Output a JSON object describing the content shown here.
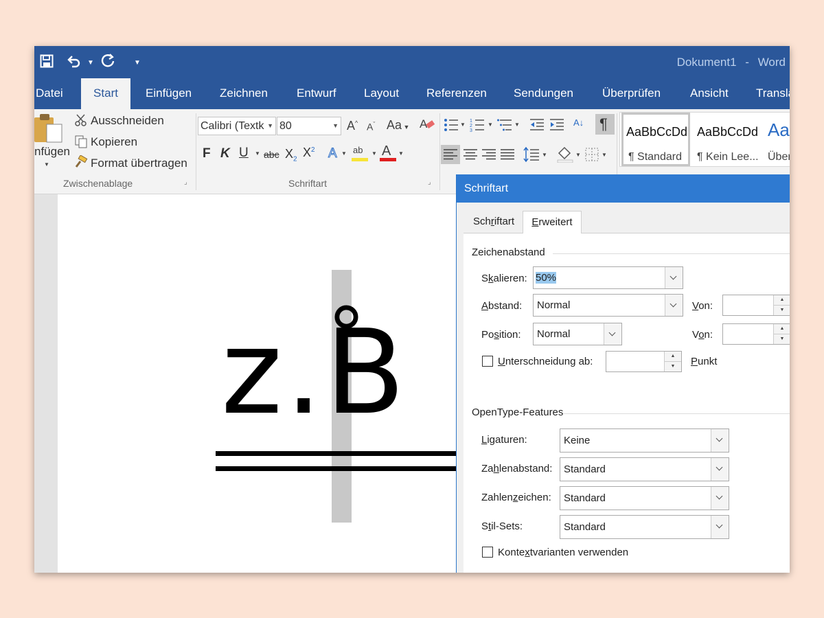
{
  "qat": {
    "save_icon": "save-icon",
    "undo_icon": "undo-icon",
    "redo_icon": "redo-icon",
    "customize_icon": "customize-qat-icon"
  },
  "title": {
    "doc": "Dokument1",
    "sep": "-",
    "app": "Word"
  },
  "tabs": [
    {
      "label": "Datei"
    },
    {
      "label": "Start"
    },
    {
      "label": "Einfügen"
    },
    {
      "label": "Zeichnen"
    },
    {
      "label": "Entwurf"
    },
    {
      "label": "Layout"
    },
    {
      "label": "Referenzen"
    },
    {
      "label": "Sendungen"
    },
    {
      "label": "Überprüfen"
    },
    {
      "label": "Ansicht"
    },
    {
      "label": "Transla"
    }
  ],
  "clipboard": {
    "paste_label": "nfügen",
    "cut_label": "Ausschneiden",
    "copy_label": "Kopieren",
    "format_label": "Format übertragen",
    "group_label": "Zwischenablage"
  },
  "font": {
    "font_name": "Calibri (Textk",
    "font_size": "80",
    "grow_label": "A",
    "shrink_label": "A",
    "case_label": "Aa",
    "bold": "F",
    "italic": "K",
    "underline": "U",
    "strike": "abc",
    "subscript": "X",
    "superscript": "X",
    "sub_mark": "2",
    "sup_mark": "2",
    "effects": "A",
    "highlight": "ab",
    "color": "A",
    "group_label": "Schriftart"
  },
  "paragraph": {
    "pilcrow": "¶",
    "sort": "A↓"
  },
  "styles": [
    {
      "sample": "AaBbCcDd",
      "name": "¶ Standard"
    },
    {
      "sample": "AaBbCcDd",
      "name": "¶ Kein Lee..."
    },
    {
      "sample": "Aa",
      "name": "Über"
    }
  ],
  "document": {
    "text": "z.B",
    "degree": "°"
  },
  "dialog": {
    "title": "Schriftart",
    "tabs": [
      {
        "label": "Schriftart"
      },
      {
        "label": "Erweitert"
      }
    ],
    "spacing_section": "Zeichenabstand",
    "scale_label": "Skalieren:",
    "scale_value": "50%",
    "spacing_label": "Abstand:",
    "spacing_value": "Normal",
    "spacing_by_label": "Von:",
    "position_label": "Position:",
    "position_value": "Normal",
    "position_by_label": "Von:",
    "kerning_label": "Unterschneidung ab:",
    "kerning_unit": "Punkt",
    "opentype_section": "OpenType-Features",
    "ligatures_label": "Ligaturen:",
    "ligatures_value": "Keine",
    "num_spacing_label": "Zahlenabstand:",
    "num_spacing_value": "Standard",
    "num_forms_label": "Zahlenzeichen:",
    "num_forms_value": "Standard",
    "stylistic_label": "Stil-Sets:",
    "stylistic_value": "Standard",
    "contextual_label": "Kontextvarianten verwenden"
  },
  "colors": {
    "titlebar": "#2b579a",
    "dialog_title": "#2f7ad1",
    "background": "#fce3d4",
    "selection": "#99c9ef",
    "highlight_yellow": "#f7e43a",
    "font_red": "#e02020"
  }
}
